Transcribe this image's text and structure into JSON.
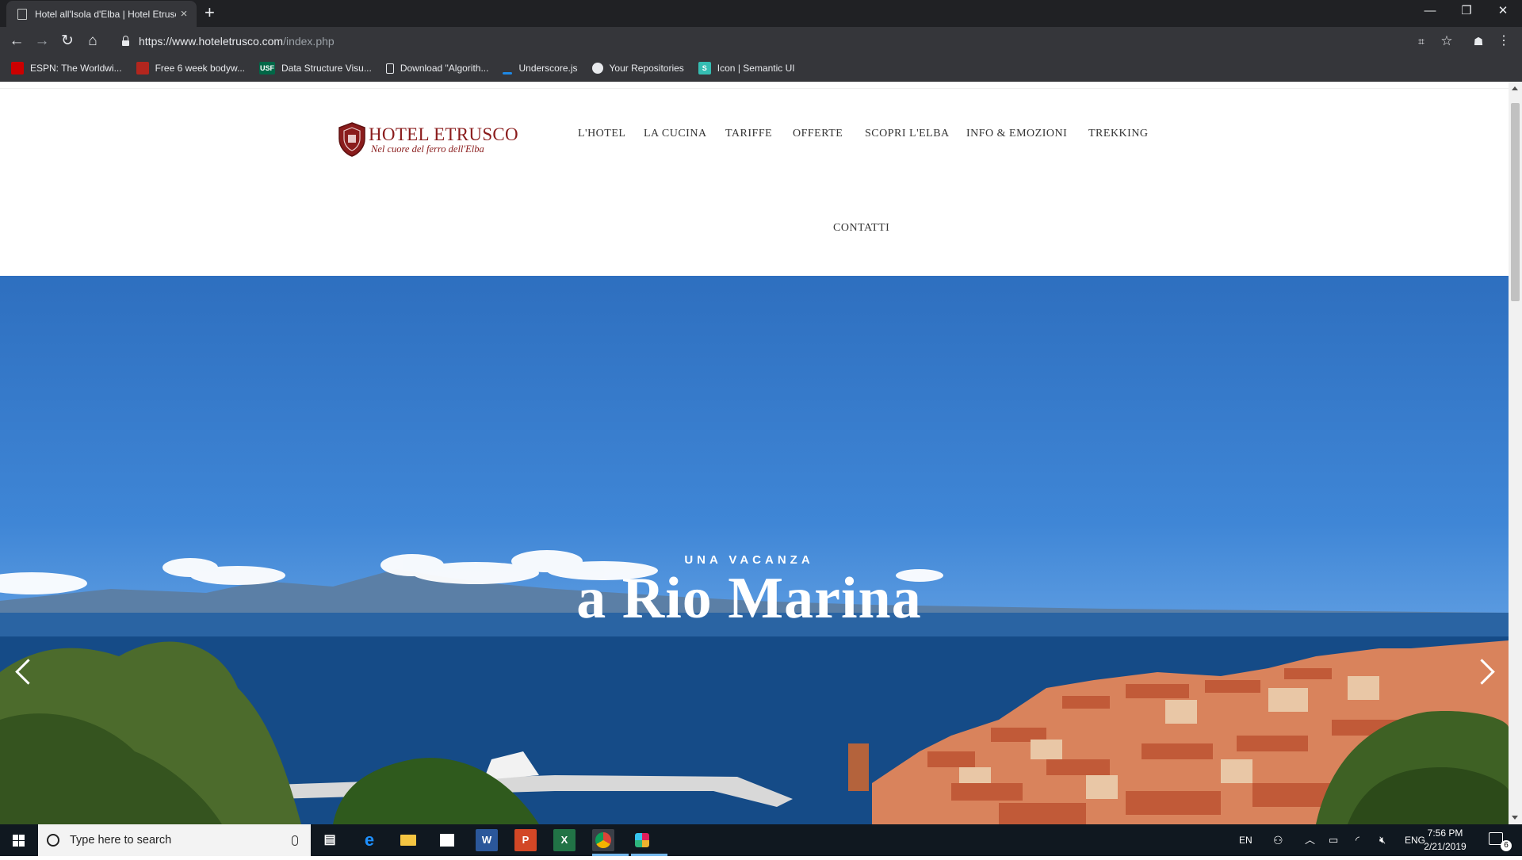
{
  "browser": {
    "tab_title": "Hotel all'Isola d'Elba | Hotel Etrusco",
    "tab_close": "×",
    "new_tab": "+",
    "window_controls": {
      "minimize": "—",
      "restore": "❐",
      "close": "✕"
    },
    "url_host": "https://www.hoteletrusco.com",
    "url_path": "/index.php",
    "bookmarks": [
      {
        "label": "ESPN: The Worldwi...",
        "icon": "espn-icon",
        "color": "#cc0000"
      },
      {
        "label": "Free 6 week bodyw...",
        "icon": "shield-icon",
        "color": "#b3261e"
      },
      {
        "label": "Data Structure Visu...",
        "icon": "usf-icon",
        "color": "#006747",
        "badge": "USF"
      },
      {
        "label": "Download \"Algorith...",
        "icon": "document-icon",
        "color": "#e8eaed"
      },
      {
        "label": "Underscore.js",
        "icon": "underscore-icon",
        "color": "#1e88e5"
      },
      {
        "label": "Your Repositories",
        "icon": "github-icon",
        "color": "#e8eaed"
      },
      {
        "label": "Icon | Semantic UI",
        "icon": "semantic-ui-icon",
        "color": "#35bdb2",
        "badge": "S"
      }
    ]
  },
  "site": {
    "logo_name": "HOTEL ETRUSCO",
    "logo_tagline": "Nel cuore del ferro dell'Elba",
    "brand_color": "#8a1c1c",
    "nav": [
      "L'HOTEL",
      "LA CUCINA",
      "TARIFFE",
      "OFFERTE",
      "SCOPRI L'ELBA",
      "INFO & EMOZIONI",
      "TREKKING",
      "CONTATTI"
    ]
  },
  "hero": {
    "eyebrow": "UNA VACANZA",
    "headline": "a Rio Marina"
  },
  "taskbar": {
    "search_placeholder": "Type here to search",
    "apps": [
      "task-view-icon",
      "edge-icon",
      "file-explorer-icon",
      "store-icon",
      "word-icon",
      "powerpoint-icon",
      "excel-icon",
      "chrome-icon",
      "slack-icon"
    ],
    "lang_short": "EN",
    "lang": "ENG",
    "time": "7:56 PM",
    "date": "2/21/2019",
    "notifications": "6"
  }
}
